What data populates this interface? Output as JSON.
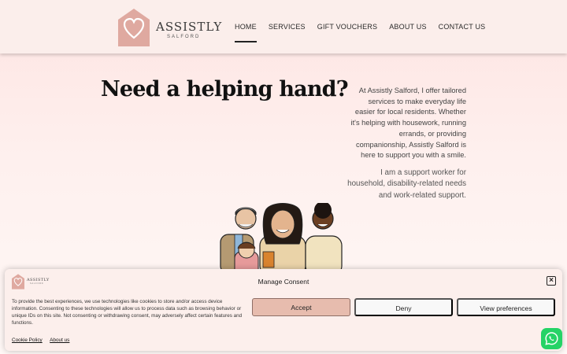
{
  "header": {
    "logo_text": "ASSISTLY",
    "logo_subtext": "SALFORD",
    "nav": [
      {
        "label": "HOME",
        "active": true
      },
      {
        "label": "SERVICES",
        "active": false
      },
      {
        "label": "GIFT VOUCHERS",
        "active": false
      },
      {
        "label": "ABOUT US",
        "active": false
      },
      {
        "label": "CONTACT US",
        "active": false
      }
    ]
  },
  "hero": {
    "title": "Need a helping hand?",
    "paragraph1": "At Assistly Salford, I offer tailored services to make everyday life easier for local residents. Whether it's helping with housework, running errands, or providing companionship, Assistly Salford is here to support you with a smile.",
    "paragraph2": "I am a support worker for household, disability-related needs and work-related support."
  },
  "consent": {
    "logo_text": "ASSISTLY",
    "logo_subtext": "SALFORD",
    "title": "Manage Consent",
    "body": "To provide the best experiences, we use technologies like cookies to store and/or access device information. Consenting to these technologies will allow us to process data such as browsing behavior or unique IDs on this site. Not consenting or withdrawing consent, may adversely affect certain features and functions.",
    "accept_label": "Accept",
    "deny_label": "Deny",
    "prefs_label": "View preferences",
    "cookie_policy_label": "Cookie Policy",
    "about_label": "About us",
    "close_icon": "close-icon"
  },
  "colors": {
    "brand_pink": "#dfa9a0",
    "accept_bg": "#e7bcae",
    "whatsapp_green": "#25d366"
  }
}
